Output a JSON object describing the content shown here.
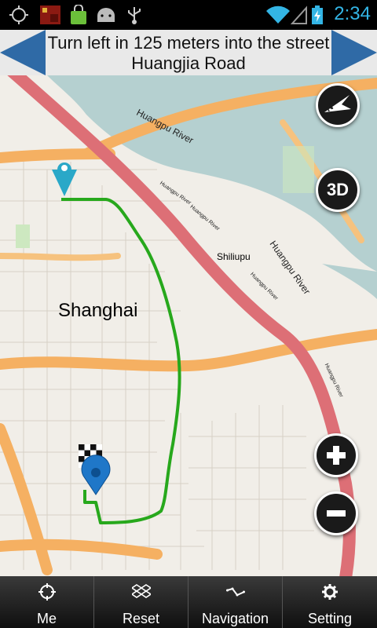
{
  "status_bar": {
    "time": "2:34",
    "icons": [
      "gps-icon",
      "app-thumbnail-icon",
      "shopping-bag-icon",
      "android-debug-icon",
      "usb-icon",
      "wifi-icon",
      "signal-icon",
      "battery-charging-icon"
    ]
  },
  "navigation": {
    "instruction": "Turn left in 125 meters into the street Huangjia Road",
    "prev_icon": "arrow-left-icon",
    "next_icon": "arrow-right-icon"
  },
  "map": {
    "city_label": "Shanghai",
    "poi_label": "Shiliupu",
    "river_labels": {
      "huangpu_upper": "Huangpu River",
      "huangpu_mid": "Huangpu River",
      "huangpu_small_1": "Huangpu River",
      "huangpu_small_2": "Huangpu River",
      "huangpu_small_3": "Huangpu River",
      "huangpu_small_4": "Huangpu River"
    },
    "compass_icon": "compass-north-icon",
    "view_mode_label": "3D",
    "zoom_in_icon": "plus-icon",
    "zoom_out_icon": "minus-icon",
    "colors": {
      "route": "#27a81c",
      "water": "#b5d0d0",
      "major_road": "#dd6f76",
      "secondary_road": "#f5b062",
      "land": "#f1eee8"
    }
  },
  "bottom_nav": {
    "tabs": [
      {
        "label": "Me",
        "icon": "crosshair-icon"
      },
      {
        "label": "Reset",
        "icon": "dropbox-icon"
      },
      {
        "label": "Navigation",
        "icon": "route-icon"
      },
      {
        "label": "Setting",
        "icon": "gear-icon"
      }
    ]
  }
}
